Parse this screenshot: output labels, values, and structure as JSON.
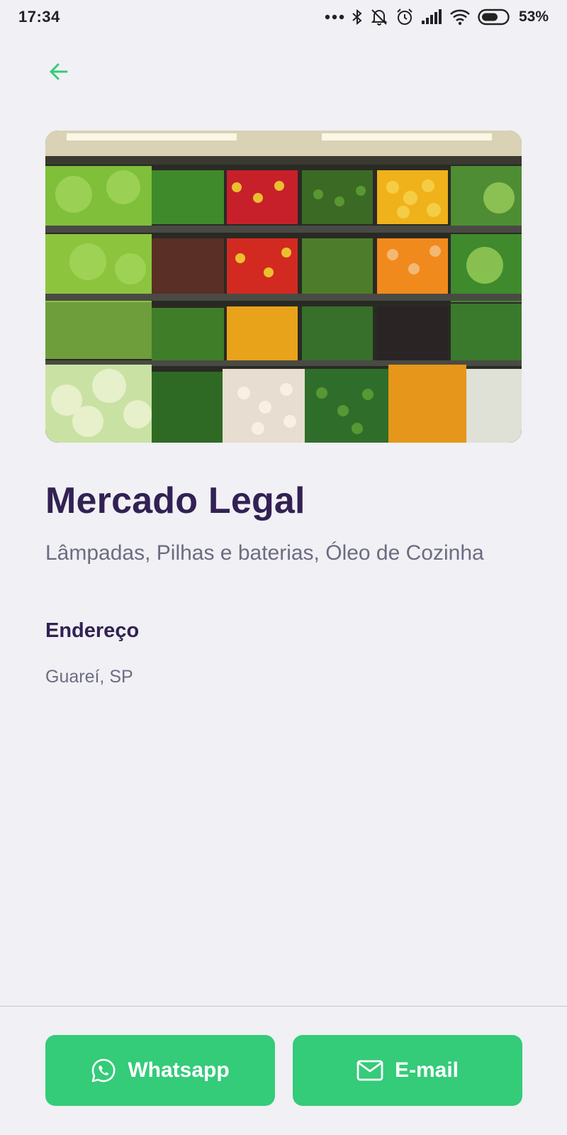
{
  "status_bar": {
    "time": "17:34",
    "battery_percent": "53%"
  },
  "place": {
    "name": "Mercado Legal",
    "items": "Lâmpadas, Pilhas e baterias, Óleo de Cozinha"
  },
  "address": {
    "heading": "Endereço",
    "value": "Guareí, SP"
  },
  "footer": {
    "whatsapp_label": "Whatsapp",
    "email_label": "E-mail"
  },
  "colors": {
    "primary": "#34cb79",
    "title": "#322153",
    "text": "#6c6c80",
    "background": "#f0f0f5"
  }
}
